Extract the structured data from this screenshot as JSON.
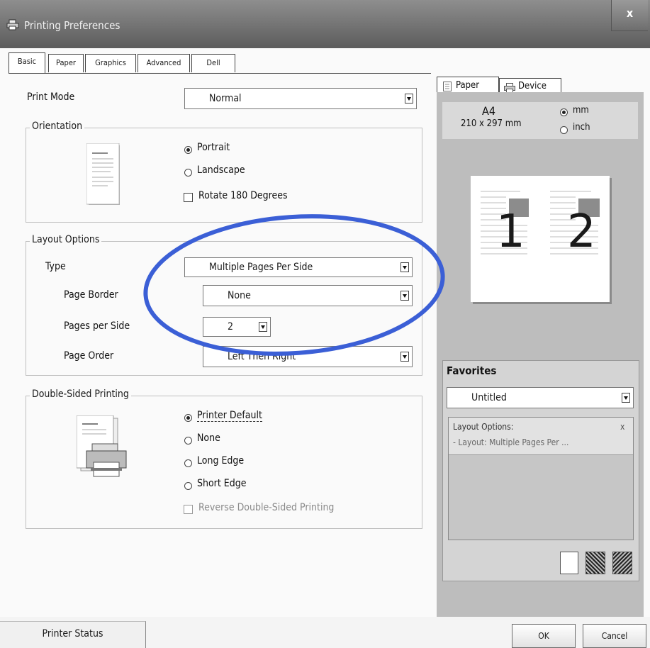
{
  "window": {
    "title": "Printing Preferences",
    "close_label": "x"
  },
  "tabs": [
    {
      "label": "Basic"
    },
    {
      "label": "Paper"
    },
    {
      "label": "Graphics"
    },
    {
      "label": "Advanced"
    },
    {
      "label": "Dell"
    }
  ],
  "print_mode": {
    "label": "Print Mode",
    "value": "Normal"
  },
  "orientation": {
    "title": "Orientation",
    "options": [
      {
        "label": "Portrait",
        "selected": true
      },
      {
        "label": "Landscape",
        "selected": false
      }
    ],
    "rotate_label": "Rotate 180 Degrees",
    "rotate_checked": false
  },
  "layout": {
    "title": "Layout Options",
    "type_label": "Type",
    "type_value": "Multiple Pages Per Side",
    "border_label": "Page Border",
    "border_value": "None",
    "pps_label": "Pages per Side",
    "pps_value": "2",
    "order_label": "Page Order",
    "order_value": "Left Then Right"
  },
  "duplex": {
    "title": "Double-Sided Printing",
    "options": [
      {
        "label": "Printer Default",
        "selected": true
      },
      {
        "label": "None",
        "selected": false
      },
      {
        "label": "Long Edge",
        "selected": false
      },
      {
        "label": "Short Edge",
        "selected": false
      }
    ],
    "reverse_label": "Reverse Double-Sided Printing",
    "reverse_checked": false,
    "reverse_enabled": false
  },
  "preview": {
    "tabs": [
      {
        "label": "Paper"
      },
      {
        "label": "Device"
      }
    ],
    "paper_size": "A4",
    "paper_dims": "210 x 297 mm",
    "units": [
      {
        "label": "mm",
        "selected": true
      },
      {
        "label": "inch",
        "selected": false
      }
    ],
    "page_numbers": [
      "1",
      "2"
    ]
  },
  "favorites": {
    "title": "Favorites",
    "selected": "Untitled",
    "summary_title": "Layout Options:",
    "summary_close": "x",
    "summary_item": "- Layout: Multiple Pages Per ..."
  },
  "buttons": {
    "printer_status": "Printer Status",
    "ok": "OK",
    "cancel": "Cancel"
  },
  "annotation": {
    "color": "#3b5fd6"
  }
}
